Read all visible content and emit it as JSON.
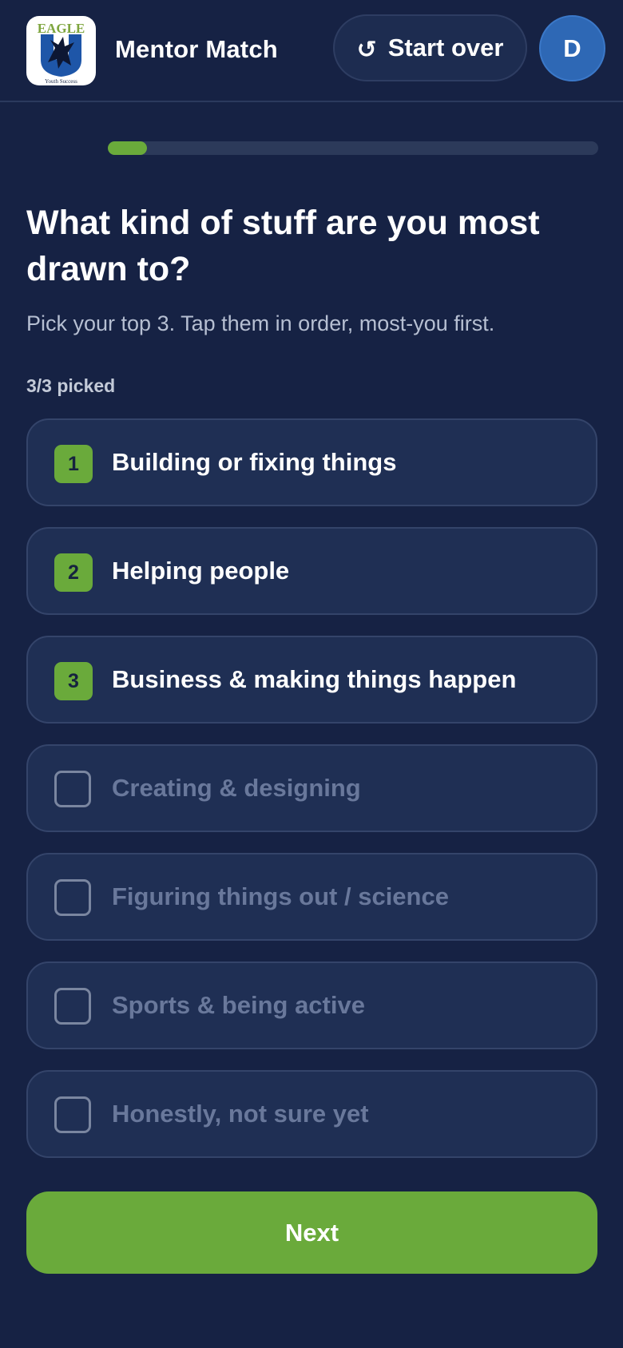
{
  "header": {
    "logo": {
      "top_text": "EAGLE",
      "bottom_text": "Youth Success",
      "colors": {
        "top_text": "#7ea53e",
        "shield": "#1e56a8",
        "eagle": "#0d1733"
      }
    },
    "title": "Mentor Match",
    "start_over": {
      "icon": "rotate-ccw-icon",
      "glyph": "↺",
      "label": "Start over"
    },
    "avatar_initial": "D"
  },
  "progress": {
    "fraction": 0.08
  },
  "question": "What kind of stuff are you most drawn to?",
  "subtitle": "Pick your top 3. Tap them in order, most-you first.",
  "picked_count": "3/3 picked",
  "options": [
    {
      "label": "Building or fixing things",
      "rank": "1",
      "selected": true
    },
    {
      "label": "Helping people",
      "rank": "2",
      "selected": true
    },
    {
      "label": "Business & making things happen",
      "rank": "3",
      "selected": true
    },
    {
      "label": "Creating & designing",
      "rank": "",
      "selected": false
    },
    {
      "label": "Figuring things out / science",
      "rank": "",
      "selected": false
    },
    {
      "label": "Sports & being active",
      "rank": "",
      "selected": false
    },
    {
      "label": "Honestly, not sure yet",
      "rank": "",
      "selected": false
    }
  ],
  "next_label": "Next",
  "colors": {
    "background": "#162244",
    "card": "#1f2f54",
    "accent_green": "#6aaa3b",
    "avatar_blue": "#2e68b5",
    "muted_text": "#69789b"
  }
}
